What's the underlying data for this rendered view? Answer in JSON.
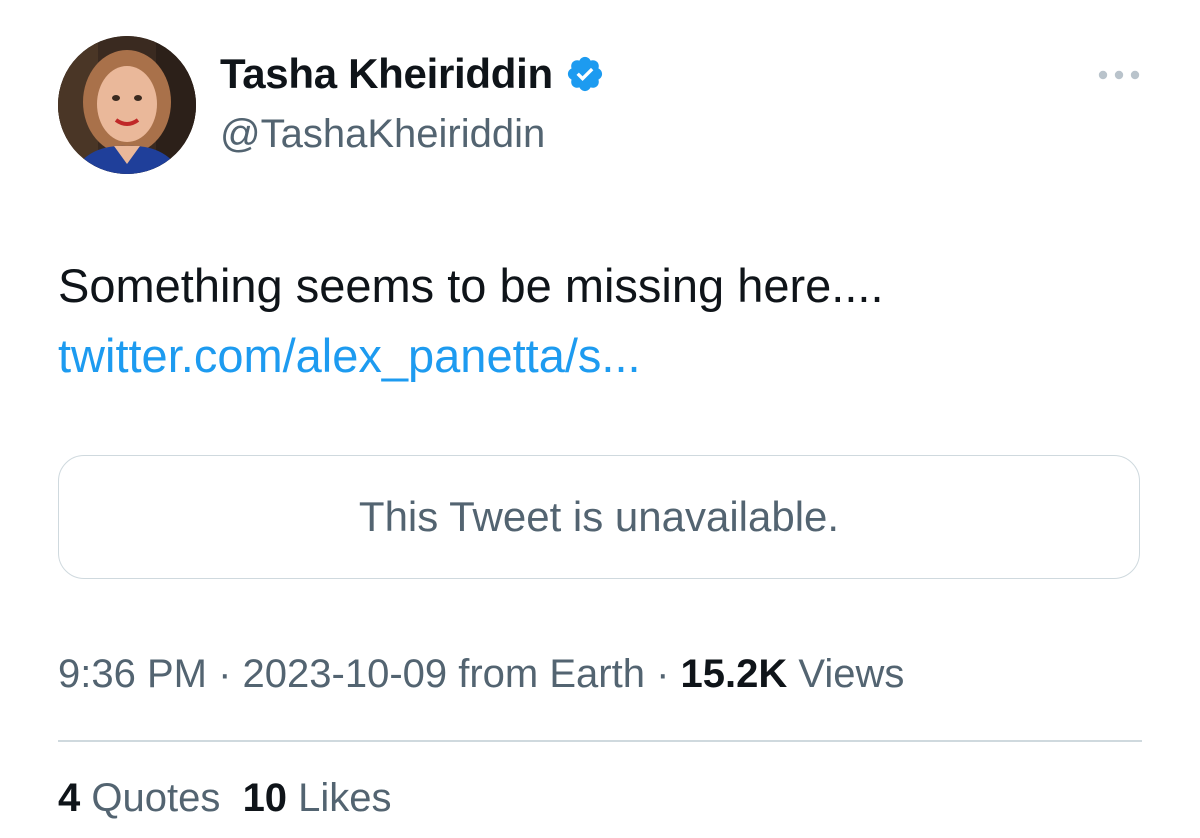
{
  "author": {
    "display_name": "Tasha Kheiriddin",
    "handle": "@TashaKheiriddin",
    "verified_icon": "verified-badge-icon",
    "verified_color": "#1d9bf0"
  },
  "more_icon": "more-horizontal-icon",
  "tweet": {
    "text": "Something seems to be missing here....",
    "link": "twitter.com/alex_panetta/s..."
  },
  "quoted_tweet": {
    "text": "This Tweet is unavailable."
  },
  "meta": {
    "time": "9:36 PM",
    "sep1": " · ",
    "date": "2023-10-09",
    "source": " from Earth",
    "sep2": " · ",
    "views_count": "15.2K",
    "views_label": " Views"
  },
  "stats": {
    "quotes_count": "4",
    "quotes_label": " Quotes",
    "likes_count": "10",
    "likes_label": " Likes"
  },
  "colors": {
    "accent": "#1d9bf0",
    "secondary_text": "#536471",
    "primary_text": "#0f1419",
    "border": "#cfd9de"
  }
}
